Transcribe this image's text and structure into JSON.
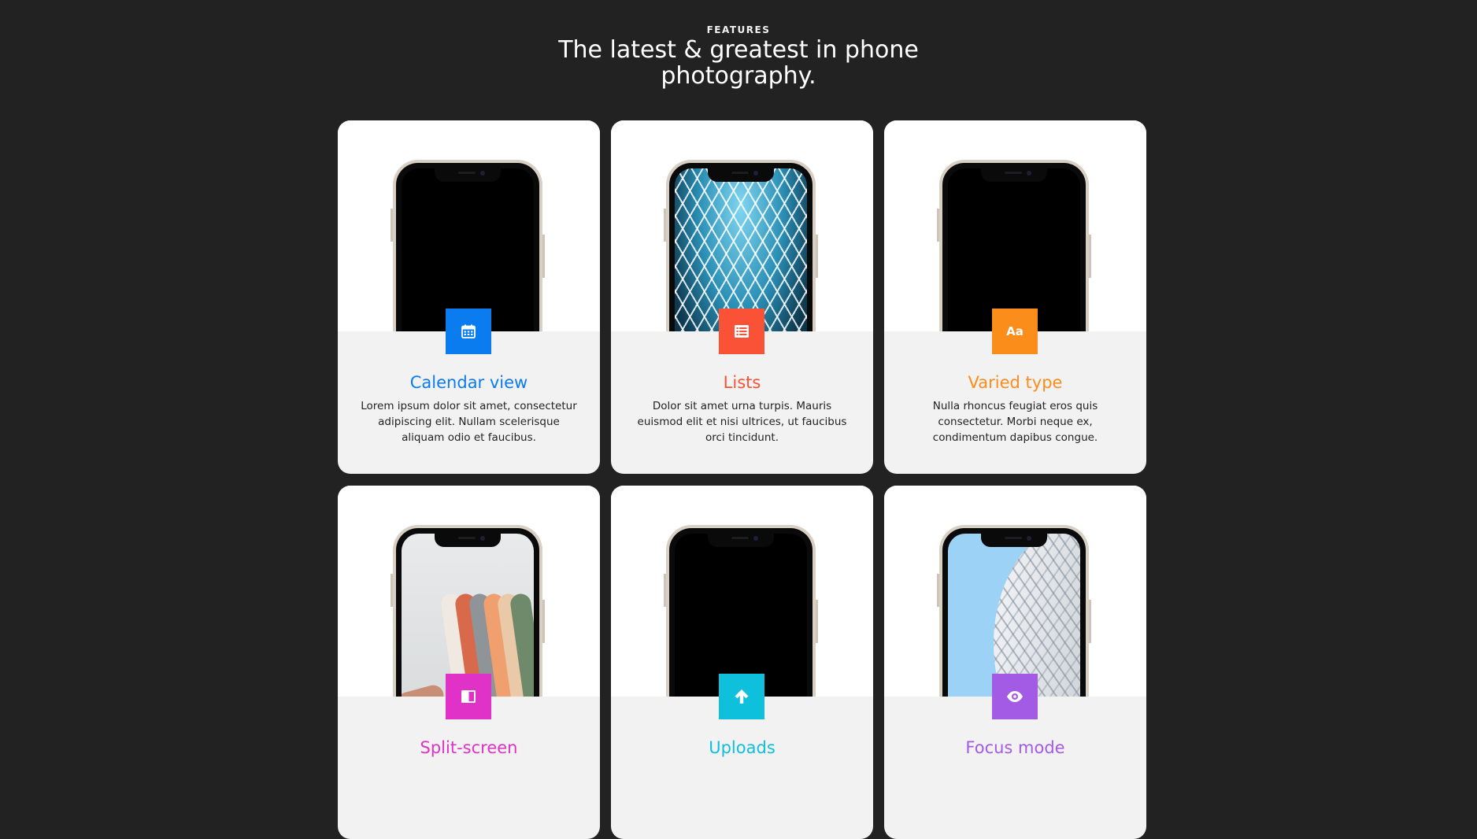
{
  "features": {
    "eyebrow": "FEATURES",
    "title": "The latest & greatest in phone photography."
  },
  "cards": [
    {
      "title": "Calendar view",
      "description": "Lorem ipsum dolor sit amet, consectetur adipiscing elit. Nullam scelerisque aliquam odio et faucibus.",
      "icon": "calendar-icon",
      "color": "#0a7cf0"
    },
    {
      "title": "Lists",
      "description": "Dolor sit amet urna turpis. Mauris euismod elit et nisi ultrices, ut faucibus orci tincidunt.",
      "icon": "list-icon",
      "color": "#fa5236"
    },
    {
      "title": "Varied type",
      "description": "Nulla rhoncus feugiat eros quis consectetur. Morbi neque ex, condimentum dapibus congue.",
      "icon": "text-type-icon",
      "icon_text": "Aa",
      "color": "#fb8d1a"
    },
    {
      "title": "Split-screen",
      "icon": "split-screen-icon",
      "color": "#e132c8"
    },
    {
      "title": "Uploads",
      "icon": "upload-arrow-icon",
      "color": "#0fc0dd"
    },
    {
      "title": "Focus mode",
      "icon": "eye-icon",
      "color": "#a35be6"
    }
  ]
}
